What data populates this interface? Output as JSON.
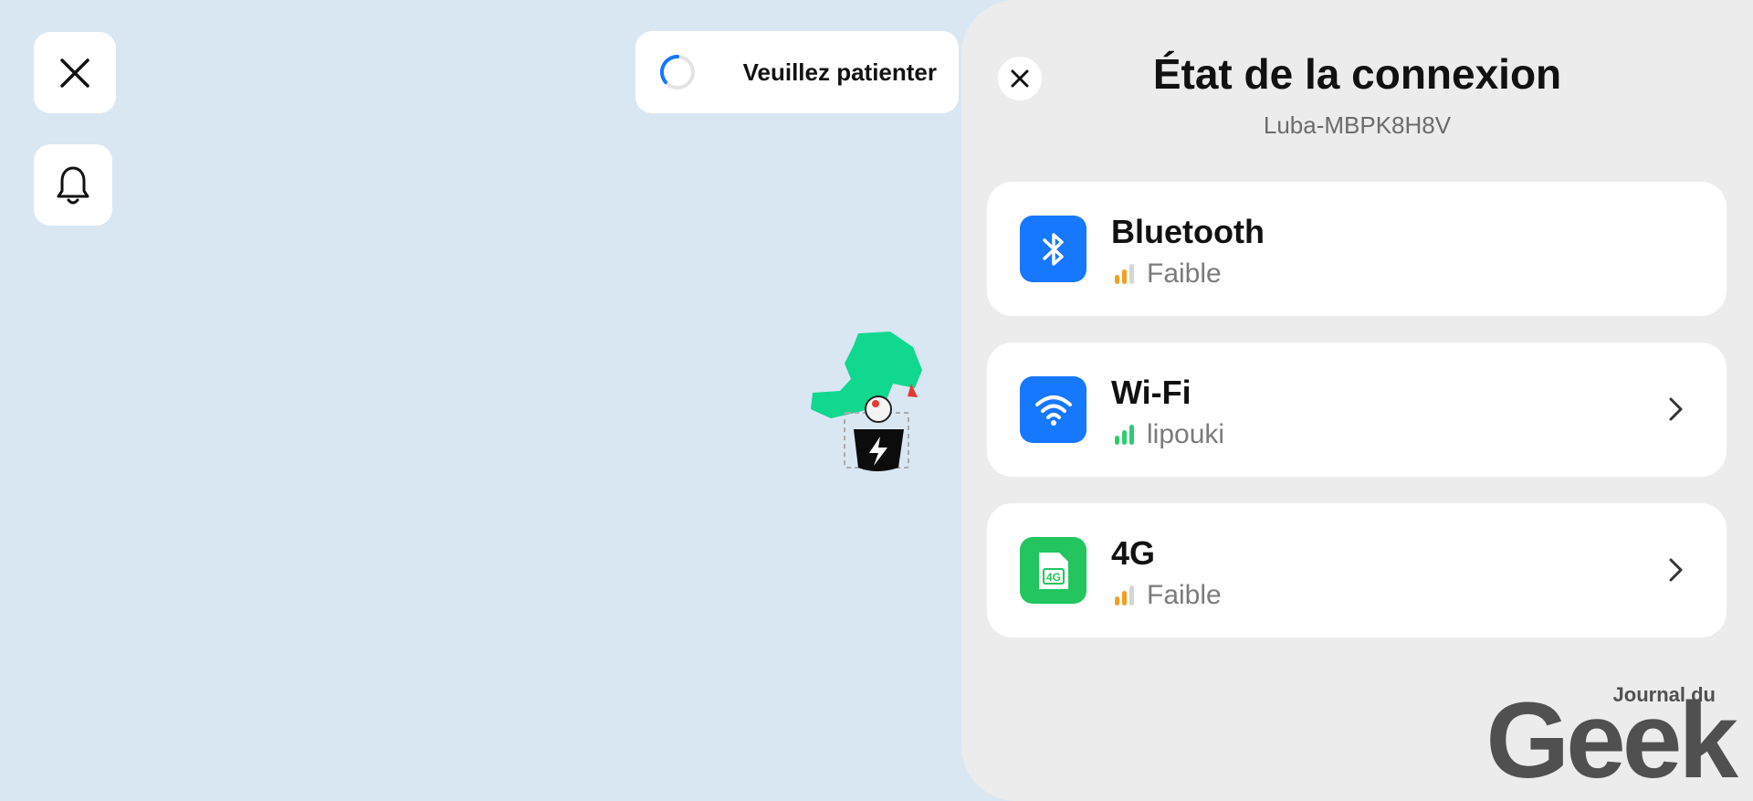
{
  "toast": {
    "text": "Veuillez patienter"
  },
  "panel": {
    "title": "État de la connexion",
    "device": "Luba-MBPK8H8V"
  },
  "connections": [
    {
      "name": "Bluetooth",
      "status": "Faible",
      "icon": "bluetooth-icon",
      "icon_color": "#1677ff",
      "signal_level": 2,
      "signal_color": "#f0a020",
      "has_chevron": false
    },
    {
      "name": "Wi-Fi",
      "status": "lipouki",
      "icon": "wifi-icon",
      "icon_color": "#1677ff",
      "signal_level": 3,
      "signal_color": "#2ecc71",
      "has_chevron": true
    },
    {
      "name": "4G",
      "status": "Faible",
      "icon": "sim-4g-icon",
      "icon_color": "#22c55e",
      "signal_level": 2,
      "signal_color": "#f0a020",
      "has_chevron": true
    }
  ],
  "watermark": {
    "small": "Journal du",
    "big": "Geek"
  },
  "colors": {
    "map_bg": "#d9e7f3",
    "panel_bg": "#ececec",
    "zone_green": "#10d88f",
    "accent_blue": "#1677ff"
  }
}
